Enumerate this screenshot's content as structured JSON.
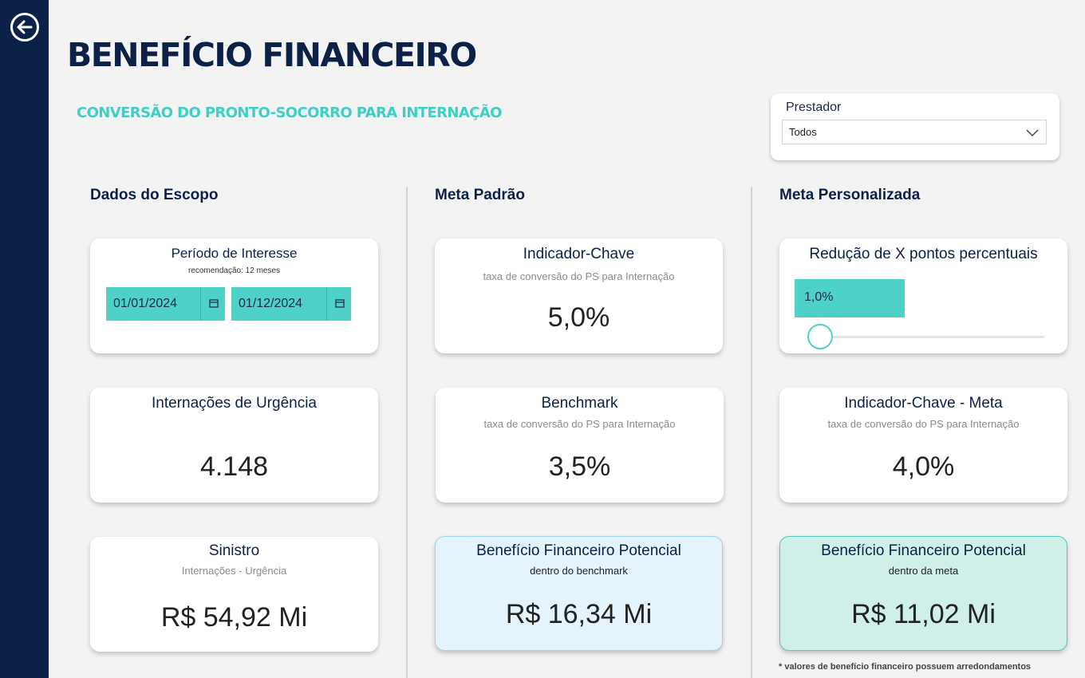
{
  "page": {
    "title": "BENEFÍCIO FINANCEIRO",
    "subtitle": "CONVERSÃO DO PRONTO-SOCORRO PARA INTERNAÇÃO",
    "footnote": "* valores de benefício financeiro possuem arredondamentos"
  },
  "filter": {
    "label": "Prestador",
    "value": "Todos"
  },
  "columns": {
    "scope": "Dados do Escopo",
    "standard": "Meta Padrão",
    "custom": "Meta Personalizada"
  },
  "scope": {
    "period": {
      "title": "Período de Interesse",
      "subtitle": "recomendação: 12 meses",
      "start": "01/01/2024",
      "end": "01/12/2024"
    },
    "admissions": {
      "title": "Internações de Urgência",
      "value": "4.148"
    },
    "claims": {
      "title": "Sinistro",
      "subtitle": "Internações - Urgência",
      "value": "R$ 54,92 Mi"
    }
  },
  "standard": {
    "indicator": {
      "title": "Indicador-Chave",
      "subtitle": "taxa de conversão do PS para Internação",
      "value": "5,0%"
    },
    "benchmark": {
      "title": "Benchmark",
      "subtitle": "taxa de conversão do PS para Internação",
      "value": "3,5%"
    },
    "benefit": {
      "title": "Benefício Financeiro Potencial",
      "subtitle": "dentro do benchmark",
      "value": "R$ 16,34 Mi"
    }
  },
  "custom": {
    "reduction": {
      "title": "Redução de X pontos percentuais",
      "value": "1,0%",
      "slider_level": 0.05
    },
    "indicator_goal": {
      "title": "Indicador-Chave - Meta",
      "subtitle": "taxa de conversão do PS para Internação",
      "value": "4,0%"
    },
    "benefit": {
      "title": "Benefício Financeiro Potencial",
      "subtitle": "dentro da meta",
      "value": "R$ 11,02 Mi"
    }
  },
  "colors": {
    "navy": "#0b2148",
    "accent_teal": "#4ed1c9",
    "subtitle_teal": "#40cfc4"
  },
  "icons": {
    "back": "back-arrow-circle-icon",
    "dropdown": "chevron-down-icon",
    "calendar": "calendar-icon"
  }
}
